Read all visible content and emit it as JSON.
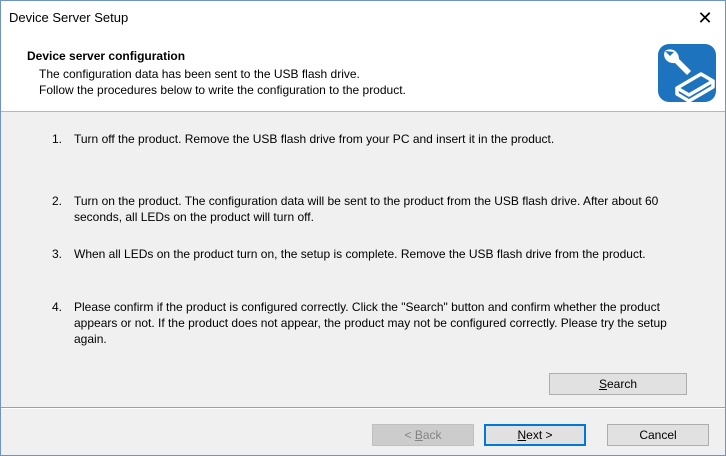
{
  "window": {
    "title": "Device Server Setup",
    "close_glyph": "✕"
  },
  "header": {
    "title": "Device server configuration",
    "line1": "The configuration data has been sent to the USB flash drive.",
    "line2": "Follow the procedures below to write the configuration to the product.",
    "icon": "usb-drive-with-wrench-icon",
    "icon_color": "#1e73be"
  },
  "steps": [
    {
      "num": "1.",
      "text": "Turn off the product. Remove the USB flash drive from your PC and insert it in the product."
    },
    {
      "num": "2.",
      "text": "Turn on the product. The configuration data will be sent to the product from the USB flash drive. After about 60 seconds, all LEDs on the product will turn off."
    },
    {
      "num": "3.",
      "text": "When all LEDs on the product turn on, the setup is complete. Remove the USB flash drive from the product."
    },
    {
      "num": "4.",
      "text": "Please confirm if the product is configured correctly. Click the \"Search\" button and confirm whether the product appears or not. If the product does not appear, the product may not be configured correctly. Please try the setup again."
    }
  ],
  "buttons": {
    "search_mnemonic": "S",
    "search_rest": "earch",
    "back_prefix": "< ",
    "back_mnemonic": "B",
    "back_rest": "ack",
    "next_mnemonic": "N",
    "next_rest": "ext >",
    "cancel": "Cancel"
  }
}
